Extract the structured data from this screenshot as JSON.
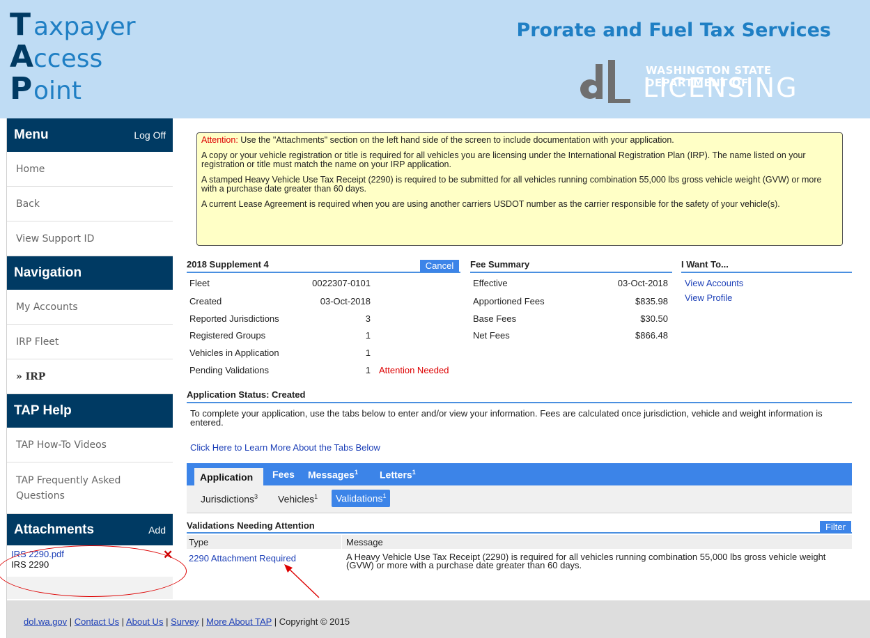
{
  "header": {
    "tap_lines": [
      {
        "letter": "T",
        "word": "axpayer"
      },
      {
        "letter": "A",
        "word": "ccess"
      },
      {
        "letter": "P",
        "word": "oint"
      }
    ],
    "title": "Prorate and Fuel Tax Services",
    "agency_line": "WASHINGTON STATE DEPARTMENT OF",
    "agency_name": "LICENSING"
  },
  "sidebar": {
    "menu_label": "Menu",
    "log_off_label": "Log Off",
    "menu_items": [
      {
        "label": "Home"
      },
      {
        "label": "Back"
      },
      {
        "label": "View Support ID"
      }
    ],
    "navigation_label": "Navigation",
    "nav_items": [
      {
        "label": "My Accounts"
      },
      {
        "label": "IRP Fleet"
      },
      {
        "label": "» IRP"
      }
    ],
    "help_label": "TAP Help",
    "help_items": [
      {
        "label": "TAP How-To Videos"
      },
      {
        "label": "TAP Frequently Asked Questions"
      }
    ],
    "attachments_label": "Attachments",
    "attachments_add_label": "Add",
    "attachment": {
      "file": "IRS 2290.pdf",
      "description": "IRS 2290",
      "remove_glyph": "✕"
    }
  },
  "attention": {
    "prefix": "Attention:",
    "p1": " Use the \"Attachments\" section on the left hand side of the screen to include documentation with your application.",
    "p2": "A copy or your vehicle registration or title is required for all vehicles you are licensing under the International Registration Plan (IRP). The name listed on your registration or title must match the name on your IRP application.",
    "p3": "A stamped Heavy Vehicle Use Tax Receipt (2290) is required to be submitted for all vehicles running combination 55,000 lbs gross vehicle weight (GVW) or more with a purchase date greater than 60 days.",
    "p4": "A current Lease Agreement is required when you are using another carriers USDOT number as the carrier responsible for the safety of your vehicle(s)."
  },
  "supplement": {
    "title": "2018 Supplement 4",
    "cancel_label": "Cancel",
    "rows": [
      {
        "label": "Fleet",
        "value": "0022307-0101"
      },
      {
        "label": "Created",
        "value": "03-Oct-2018"
      },
      {
        "label": "Reported Jurisdictions",
        "value": "3"
      },
      {
        "label": "Registered Groups",
        "value": "1"
      },
      {
        "label": "Vehicles in Application",
        "value": "1"
      },
      {
        "label": "Pending Validations",
        "value": "1"
      }
    ],
    "attention_needed": "Attention Needed"
  },
  "fees": {
    "title": "Fee Summary",
    "rows": [
      {
        "label": "Effective",
        "value": "03-Oct-2018"
      },
      {
        "label": "Apportioned Fees",
        "value": "$835.98"
      },
      {
        "label": "Base Fees",
        "value": "$30.50"
      },
      {
        "label": "Net Fees",
        "value": "$866.48"
      }
    ]
  },
  "want_to": {
    "title": "I Want To...",
    "links": [
      {
        "label": "View Accounts"
      },
      {
        "label": "View Profile"
      }
    ]
  },
  "status": {
    "title": "Application Status: Created",
    "text": "To complete your application, use the tabs below to enter and/or view your information. Fees are calculated once jurisdiction, vehicle and weight information is entered.",
    "learn_link": "Click Here to Learn More About the Tabs Below"
  },
  "tabs": [
    {
      "label": "Application",
      "badge": ""
    },
    {
      "label": "Fees",
      "badge": ""
    },
    {
      "label": "Messages",
      "badge": "1"
    },
    {
      "label": "Letters",
      "badge": "1"
    }
  ],
  "subtabs": [
    {
      "label": "Jurisdictions",
      "badge": "3"
    },
    {
      "label": "Vehicles",
      "badge": "1"
    },
    {
      "label": "Validations",
      "badge": "1"
    }
  ],
  "validations": {
    "title": "Validations Needing Attention",
    "filter_label": "Filter",
    "columns": [
      "Type",
      "Message"
    ],
    "rows": [
      {
        "type": "2290 Attachment Required",
        "message": "A Heavy Vehicle Use Tax Receipt (2290) is required for all vehicles running combination 55,000 lbs gross vehicle weight (GVW) or more with a purchase date greater than 60 days."
      }
    ]
  },
  "footer": {
    "links": [
      "dol.wa.gov",
      "Contact Us",
      "About Us",
      "Survey",
      "More About TAP"
    ],
    "separator": " | ",
    "copyright": "Copyright © 2015"
  },
  "colors": {
    "header_bg": "#bfdcf4",
    "navy": "#003a63",
    "accent_blue": "#3c84e8",
    "link": "#1c3fb7",
    "alert_red": "#dd0000",
    "attention_bg": "#ffffc6"
  }
}
